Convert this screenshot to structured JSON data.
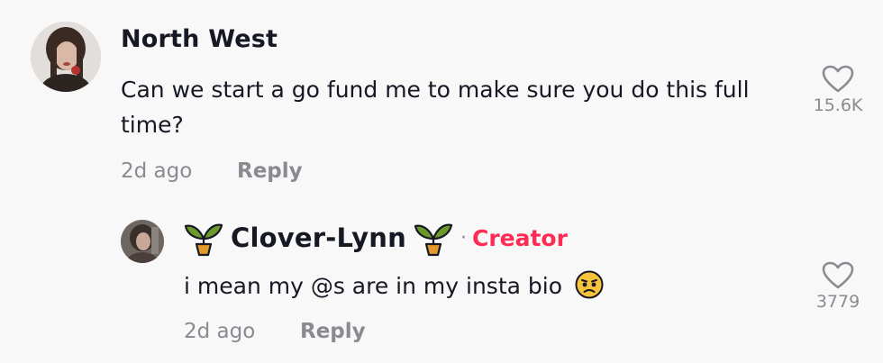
{
  "comment": {
    "username": "North West",
    "text": "Can we start a go fund me to make sure you do this full time?",
    "time": "2d ago",
    "reply_label": "Reply",
    "like_count": "15.6K",
    "avatar_icon": "profile-photo"
  },
  "reply": {
    "username": "Clover-Lynn",
    "badge_separator": "·",
    "badge": "Creator",
    "text": "i mean my @s are in my insta bio",
    "emoji": "worried-face-icon",
    "time": "2d ago",
    "reply_label": "Reply",
    "like_count": "3779",
    "avatar_icon": "profile-photo",
    "name_decoration_icon": "sprout-icon"
  },
  "colors": {
    "background": "#f8f8f8",
    "text": "#161823",
    "muted": "#8a8b91",
    "creator": "#fe2c55",
    "sprout_leaf": "#6b9a2a",
    "sprout_pot": "#e39a2a"
  }
}
